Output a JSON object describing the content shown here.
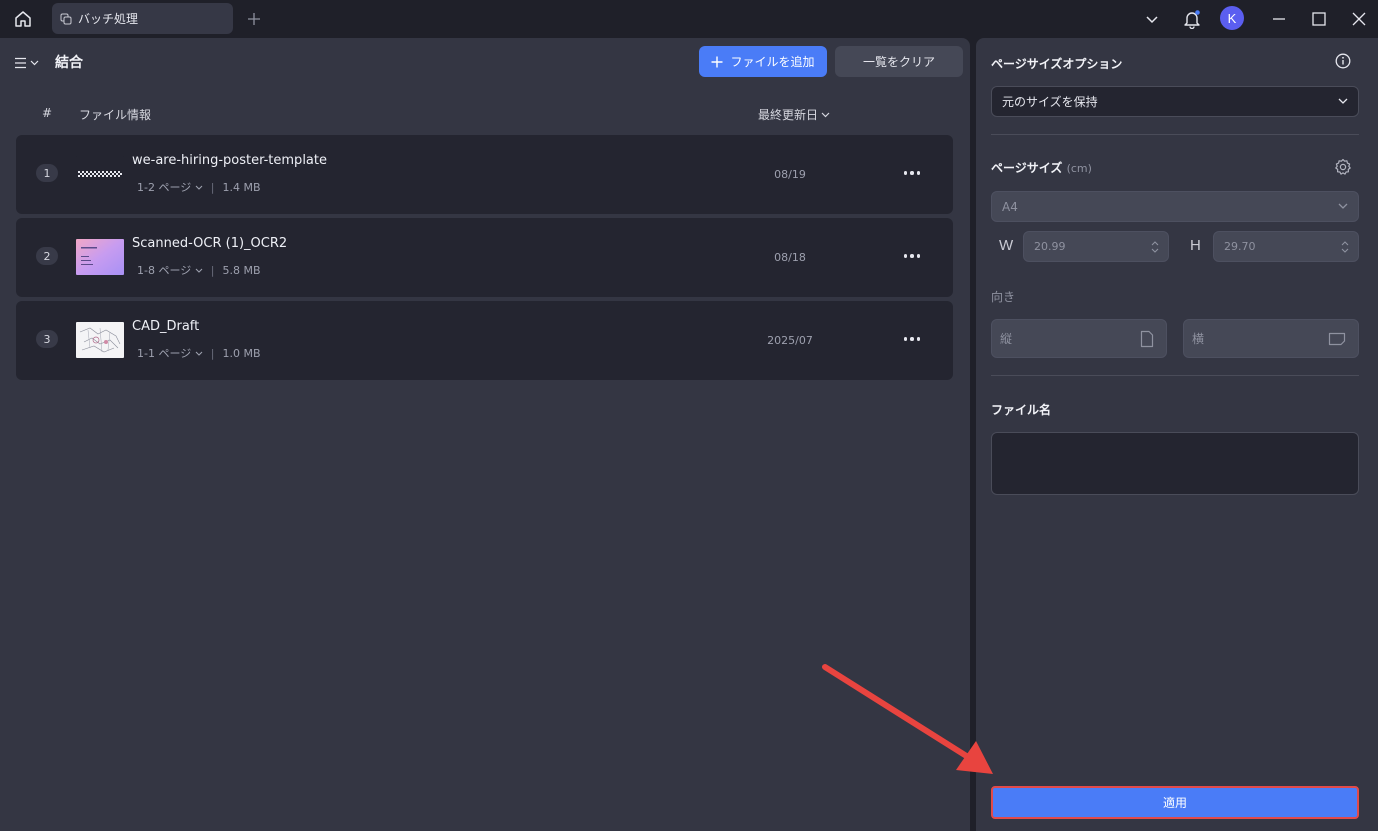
{
  "titlebar": {
    "tab_label": "バッチ処理",
    "avatar_letter": "K"
  },
  "left": {
    "title": "結合",
    "add_button": "ファイルを追加",
    "clear_button": "一覧をクリア",
    "columns": {
      "number": "#",
      "file_info": "ファイル情報",
      "last_modified": "最終更新日"
    },
    "files": [
      {
        "num": "1",
        "name": "we-are-hiring-poster-template",
        "pages": "1-2 ページ",
        "size": "1.4 MB",
        "date": "08/19"
      },
      {
        "num": "2",
        "name": "Scanned-OCR (1)_OCR2",
        "pages": "1-8 ページ",
        "size": "5.8 MB",
        "date": "08/18"
      },
      {
        "num": "3",
        "name": "CAD_Draft",
        "pages": "1-1 ページ",
        "size": "1.0 MB",
        "date": "2025/07"
      }
    ]
  },
  "right": {
    "page_size_options_title": "ページサイズオプション",
    "page_size_option_value": "元のサイズを保持",
    "page_size_title": "ページサイズ",
    "page_size_unit": "(cm)",
    "paper_size": "A4",
    "width_label": "W",
    "width_value": "20.99",
    "height_label": "H",
    "height_value": "29.70",
    "orientation_label": "向き",
    "portrait_label": "縦",
    "landscape_label": "横",
    "file_name_title": "ファイル名",
    "file_name_value": "",
    "apply_button": "適用"
  },
  "colors": {
    "accent": "#4a7cf7",
    "highlight_border": "#e24a4a",
    "annotation_arrow": "#e8443f"
  }
}
